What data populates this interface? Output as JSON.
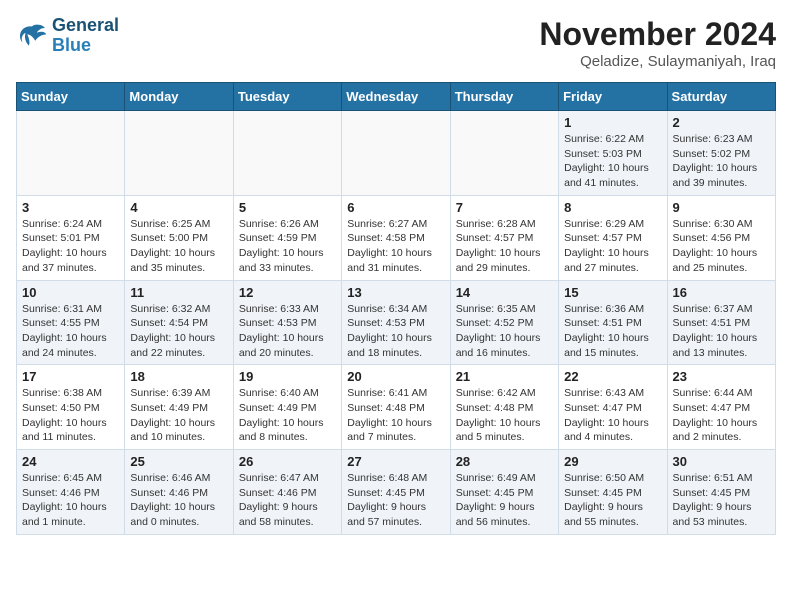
{
  "logo": {
    "line1": "General",
    "line2": "Blue"
  },
  "title": "November 2024",
  "location": "Qeladize, Sulaymaniyah, Iraq",
  "days_of_week": [
    "Sunday",
    "Monday",
    "Tuesday",
    "Wednesday",
    "Thursday",
    "Friday",
    "Saturday"
  ],
  "weeks": [
    [
      {
        "day": "",
        "content": ""
      },
      {
        "day": "",
        "content": ""
      },
      {
        "day": "",
        "content": ""
      },
      {
        "day": "",
        "content": ""
      },
      {
        "day": "",
        "content": ""
      },
      {
        "day": "1",
        "content": "Sunrise: 6:22 AM\nSunset: 5:03 PM\nDaylight: 10 hours\nand 41 minutes."
      },
      {
        "day": "2",
        "content": "Sunrise: 6:23 AM\nSunset: 5:02 PM\nDaylight: 10 hours\nand 39 minutes."
      }
    ],
    [
      {
        "day": "3",
        "content": "Sunrise: 6:24 AM\nSunset: 5:01 PM\nDaylight: 10 hours\nand 37 minutes."
      },
      {
        "day": "4",
        "content": "Sunrise: 6:25 AM\nSunset: 5:00 PM\nDaylight: 10 hours\nand 35 minutes."
      },
      {
        "day": "5",
        "content": "Sunrise: 6:26 AM\nSunset: 4:59 PM\nDaylight: 10 hours\nand 33 minutes."
      },
      {
        "day": "6",
        "content": "Sunrise: 6:27 AM\nSunset: 4:58 PM\nDaylight: 10 hours\nand 31 minutes."
      },
      {
        "day": "7",
        "content": "Sunrise: 6:28 AM\nSunset: 4:57 PM\nDaylight: 10 hours\nand 29 minutes."
      },
      {
        "day": "8",
        "content": "Sunrise: 6:29 AM\nSunset: 4:57 PM\nDaylight: 10 hours\nand 27 minutes."
      },
      {
        "day": "9",
        "content": "Sunrise: 6:30 AM\nSunset: 4:56 PM\nDaylight: 10 hours\nand 25 minutes."
      }
    ],
    [
      {
        "day": "10",
        "content": "Sunrise: 6:31 AM\nSunset: 4:55 PM\nDaylight: 10 hours\nand 24 minutes."
      },
      {
        "day": "11",
        "content": "Sunrise: 6:32 AM\nSunset: 4:54 PM\nDaylight: 10 hours\nand 22 minutes."
      },
      {
        "day": "12",
        "content": "Sunrise: 6:33 AM\nSunset: 4:53 PM\nDaylight: 10 hours\nand 20 minutes."
      },
      {
        "day": "13",
        "content": "Sunrise: 6:34 AM\nSunset: 4:53 PM\nDaylight: 10 hours\nand 18 minutes."
      },
      {
        "day": "14",
        "content": "Sunrise: 6:35 AM\nSunset: 4:52 PM\nDaylight: 10 hours\nand 16 minutes."
      },
      {
        "day": "15",
        "content": "Sunrise: 6:36 AM\nSunset: 4:51 PM\nDaylight: 10 hours\nand 15 minutes."
      },
      {
        "day": "16",
        "content": "Sunrise: 6:37 AM\nSunset: 4:51 PM\nDaylight: 10 hours\nand 13 minutes."
      }
    ],
    [
      {
        "day": "17",
        "content": "Sunrise: 6:38 AM\nSunset: 4:50 PM\nDaylight: 10 hours\nand 11 minutes."
      },
      {
        "day": "18",
        "content": "Sunrise: 6:39 AM\nSunset: 4:49 PM\nDaylight: 10 hours\nand 10 minutes."
      },
      {
        "day": "19",
        "content": "Sunrise: 6:40 AM\nSunset: 4:49 PM\nDaylight: 10 hours\nand 8 minutes."
      },
      {
        "day": "20",
        "content": "Sunrise: 6:41 AM\nSunset: 4:48 PM\nDaylight: 10 hours\nand 7 minutes."
      },
      {
        "day": "21",
        "content": "Sunrise: 6:42 AM\nSunset: 4:48 PM\nDaylight: 10 hours\nand 5 minutes."
      },
      {
        "day": "22",
        "content": "Sunrise: 6:43 AM\nSunset: 4:47 PM\nDaylight: 10 hours\nand 4 minutes."
      },
      {
        "day": "23",
        "content": "Sunrise: 6:44 AM\nSunset: 4:47 PM\nDaylight: 10 hours\nand 2 minutes."
      }
    ],
    [
      {
        "day": "24",
        "content": "Sunrise: 6:45 AM\nSunset: 4:46 PM\nDaylight: 10 hours\nand 1 minute."
      },
      {
        "day": "25",
        "content": "Sunrise: 6:46 AM\nSunset: 4:46 PM\nDaylight: 10 hours\nand 0 minutes."
      },
      {
        "day": "26",
        "content": "Sunrise: 6:47 AM\nSunset: 4:46 PM\nDaylight: 9 hours\nand 58 minutes."
      },
      {
        "day": "27",
        "content": "Sunrise: 6:48 AM\nSunset: 4:45 PM\nDaylight: 9 hours\nand 57 minutes."
      },
      {
        "day": "28",
        "content": "Sunrise: 6:49 AM\nSunset: 4:45 PM\nDaylight: 9 hours\nand 56 minutes."
      },
      {
        "day": "29",
        "content": "Sunrise: 6:50 AM\nSunset: 4:45 PM\nDaylight: 9 hours\nand 55 minutes."
      },
      {
        "day": "30",
        "content": "Sunrise: 6:51 AM\nSunset: 4:45 PM\nDaylight: 9 hours\nand 53 minutes."
      }
    ]
  ]
}
